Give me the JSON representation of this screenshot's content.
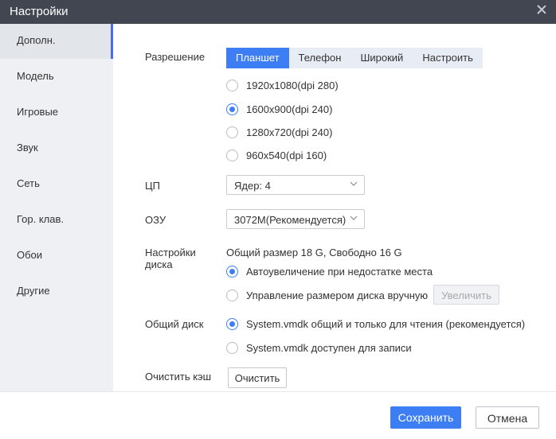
{
  "window": {
    "title": "Настройки"
  },
  "sidebar": {
    "items": [
      {
        "label": "Дополн.",
        "active": true
      },
      {
        "label": "Модель"
      },
      {
        "label": "Игровые"
      },
      {
        "label": "Звук"
      },
      {
        "label": "Сеть"
      },
      {
        "label": "Гор. клав."
      },
      {
        "label": "Обои"
      },
      {
        "label": "Другие"
      }
    ]
  },
  "resolution": {
    "label": "Разрешение",
    "tabs": [
      "Планшет",
      "Телефон",
      "Широкий",
      "Настроить"
    ],
    "selected_tab": "Планшет",
    "options": [
      "1920x1080(dpi 280)",
      "1600x900(dpi 240)",
      "1280x720(dpi 240)",
      "960x540(dpi 160)"
    ],
    "selected_option": "1600x900(dpi 240)"
  },
  "cpu": {
    "label": "ЦП",
    "value": "Ядер: 4"
  },
  "ram": {
    "label": "ОЗУ",
    "value": "3072M(Рекомендуется)"
  },
  "disk": {
    "label_line1": "Настройки",
    "label_line2": "диска",
    "info": "Общий размер 18 G, Свободно 16 G",
    "options": [
      "Автоувеличение при недостатке места",
      "Управление размером диска вручную"
    ],
    "selected_option": "Автоувеличение при недостатке места",
    "increase_button": "Увеличить"
  },
  "shared_disk": {
    "label": "Общий диск",
    "options": [
      "System.vmdk общий и только для чтения (рекомендуется)",
      "System.vmdk доступен для записи"
    ],
    "selected_option": "System.vmdk общий и только для чтения (рекомендуется)"
  },
  "cache": {
    "label": "Очистить кэш",
    "button": "Очистить"
  },
  "footer": {
    "save": "Сохранить",
    "cancel": "Отмена"
  },
  "colors": {
    "accent": "#3d7ef5",
    "titlebar": "#424650",
    "sidebar": "#eff0f3"
  }
}
